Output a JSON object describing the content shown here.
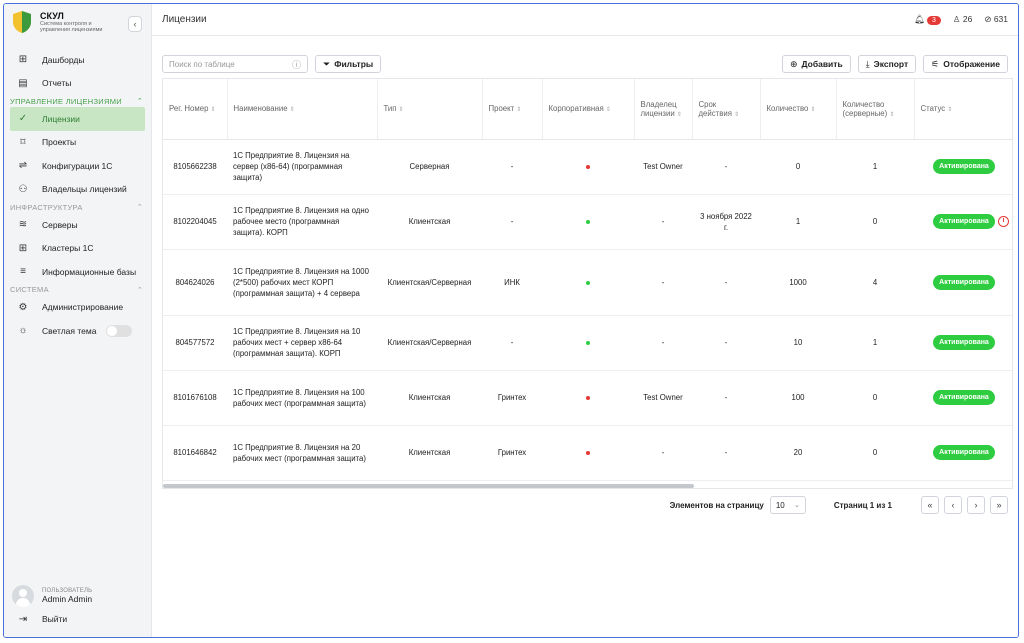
{
  "brand": {
    "name": "СКУЛ",
    "subtitle": "Система контроля и управления лицензиями"
  },
  "nav": {
    "dashboards": "Дашборды",
    "reports": "Отчеты",
    "section_licenses": "Управление лицензиями",
    "licenses": "Лицензии",
    "projects": "Проекты",
    "configs": "Конфигурации 1С",
    "owners": "Владельцы лицензий",
    "section_infra": "Инфраструктура",
    "servers": "Серверы",
    "clusters": "Кластеры 1С",
    "infobases": "Информационные базы",
    "section_system": "Система",
    "admin": "Администрирование",
    "theme": "Светлая тема"
  },
  "user": {
    "caption": "Пользователь",
    "name": "Admin Admin",
    "logout": "Выйти"
  },
  "header": {
    "title": "Лицензии",
    "notifications": "3",
    "users": "26",
    "checks": "631"
  },
  "toolbar": {
    "search_placeholder": "Поиск по таблице",
    "filters": "Фильтры",
    "add": "Добавить",
    "export": "Экспорт",
    "display": "Отображение"
  },
  "table": {
    "columns": [
      "Рег. Номер",
      "Наименование",
      "Тип",
      "Проект",
      "Корпоративная",
      "Владелец лицензии",
      "Срок действия",
      "Количество",
      "Количество (серверные)",
      "Статус"
    ],
    "rows": [
      {
        "reg": "8105662238",
        "name": "1С Предприятие 8. Лицензия на сервер (x86-64) (программная защита)",
        "type": "Серверная",
        "project": "-",
        "corp_color": "#e53935",
        "owner": "Test Owner",
        "term": "-",
        "qty": "0",
        "qty_srv": "1",
        "status": "Активирована"
      },
      {
        "reg": "8102204045",
        "name": "1С Предприятие 8. Лицензия на одно рабочее место (программная защита). КОРП",
        "type": "Клиентская",
        "project": "-",
        "corp_color": "#2ecc40",
        "owner": "-",
        "term": "3 ноября 2022 г.",
        "qty": "1",
        "qty_srv": "0",
        "status": "Активирована"
      },
      {
        "reg": "804624026",
        "name": "1С Предприятие 8. Лицензия на 1000 (2*500) рабочих мест КОРП (программная защита) + 4 сервера",
        "type": "Клиентская/Серверная",
        "project": "ИНК",
        "corp_color": "#2ecc40",
        "owner": "-",
        "term": "-",
        "qty": "1000",
        "qty_srv": "4",
        "status": "Активирована"
      },
      {
        "reg": "804577572",
        "name": "1С Предприятие 8. Лицензия на 10 рабочих мест + сервер x86-64 (программная защита). КОРП",
        "type": "Клиентская/Серверная",
        "project": "-",
        "corp_color": "#2ecc40",
        "owner": "-",
        "term": "-",
        "qty": "10",
        "qty_srv": "1",
        "status": "Активирована"
      },
      {
        "reg": "8101676108",
        "name": "1С Предприятие 8. Лицензия на 100 рабочих мест (программная защита)",
        "type": "Клиентская",
        "project": "Гринтех",
        "corp_color": "#e53935",
        "owner": "Test Owner",
        "term": "-",
        "qty": "100",
        "qty_srv": "0",
        "status": "Активирована"
      },
      {
        "reg": "8101646842",
        "name": "1С Предприятие 8. Лицензия на 20 рабочих мест (программная защита)",
        "type": "Клиентская",
        "project": "Гринтех",
        "corp_color": "#e53935",
        "owner": "-",
        "term": "-",
        "qty": "20",
        "qty_srv": "0",
        "status": "Активирована"
      }
    ]
  },
  "pagination": {
    "per_page_label": "Элементов на страницу",
    "per_page": "10",
    "pages": "Страниц 1 из 1"
  },
  "colors": {
    "accent": "#2e7d32",
    "active_bg": "#c8e6c4",
    "status": "#2ecc40",
    "danger": "#e53935"
  }
}
